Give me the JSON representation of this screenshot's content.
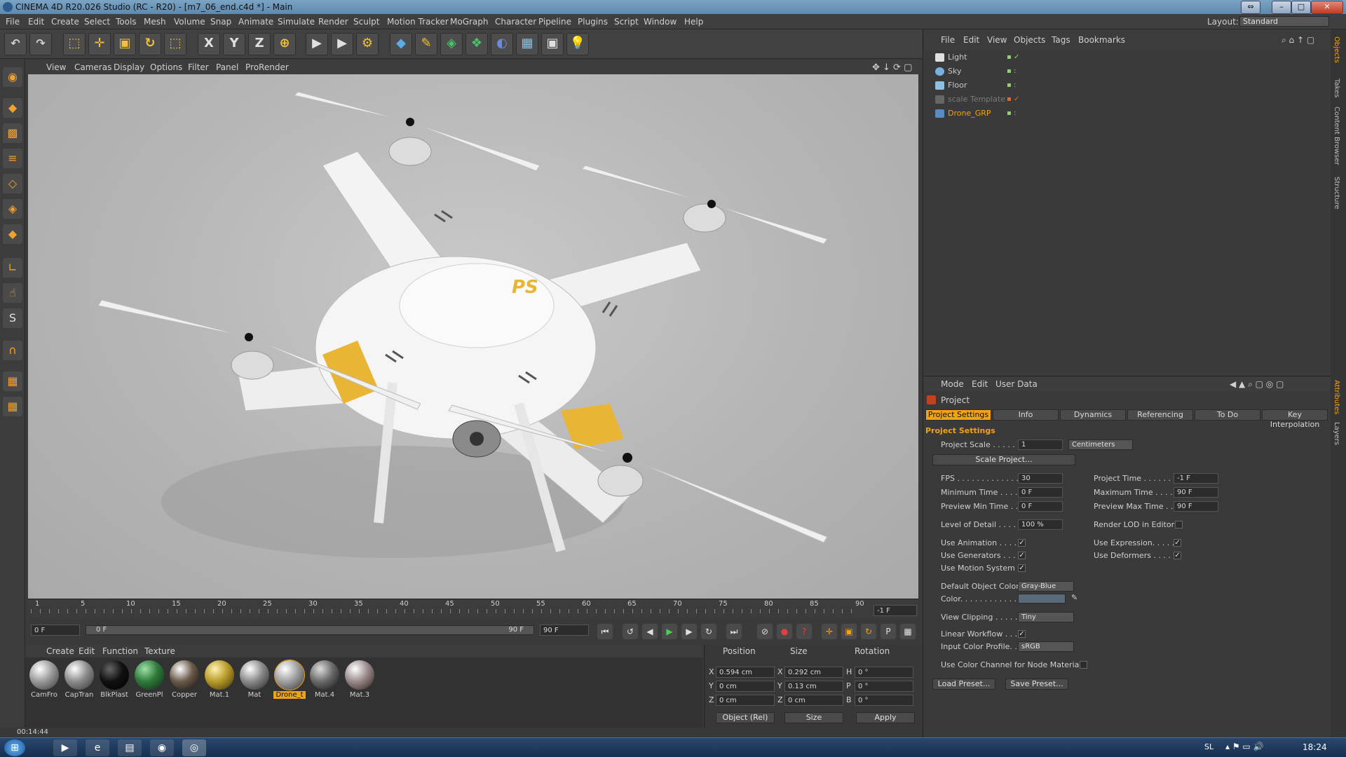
{
  "window": {
    "title": "CINEMA 4D R20.026 Studio (RC - R20) - [m7_06_end.c4d *] - Main",
    "layout_label": "Layout:",
    "layout_value": "Standard"
  },
  "menu": [
    "File",
    "Edit",
    "Create",
    "Select",
    "Tools",
    "Mesh",
    "Volume",
    "Snap",
    "Animate",
    "Simulate",
    "Render",
    "Sculpt",
    "Motion Tracker",
    "MoGraph",
    "Character",
    "Pipeline",
    "Plugins",
    "Script",
    "Window",
    "Help"
  ],
  "toolbar": {
    "axis_x": "X",
    "axis_y": "Y",
    "axis_z": "Z"
  },
  "viewport": {
    "menu": [
      "View",
      "Cameras",
      "Display",
      "Options",
      "Filter",
      "Panel",
      "ProRender"
    ],
    "logo_text": "PS"
  },
  "timeline": {
    "ticks": [
      "1",
      "5",
      "10",
      "15",
      "20",
      "25",
      "30",
      "35",
      "40",
      "45",
      "50",
      "55",
      "60",
      "65",
      "70",
      "75",
      "80",
      "85",
      "90"
    ],
    "current_frame": "-1 F"
  },
  "transport": {
    "start_field": "0 F",
    "range_start": "0 F",
    "range_end": "90 F",
    "end_field": "90 F"
  },
  "materials": {
    "menu": [
      "Create",
      "Edit",
      "Function",
      "Texture"
    ],
    "items": [
      {
        "label": "CamFro",
        "color": "#9a9a9a"
      },
      {
        "label": "CapTran",
        "color": "#8c8c8c"
      },
      {
        "label": "BlkPlast",
        "color": "#111111"
      },
      {
        "label": "GreenPl",
        "color": "#2e7a3a"
      },
      {
        "label": "Copper",
        "color": "#6a5a4a"
      },
      {
        "label": "Mat.1",
        "color": "#b89a2a"
      },
      {
        "label": "Mat",
        "color": "#8a8a8a"
      },
      {
        "label": "Drone_t",
        "color": "#a0a0a0"
      },
      {
        "label": "Mat.4",
        "color": "#6a6a6a"
      },
      {
        "label": "Mat.3",
        "color": "#9a8a8a"
      }
    ]
  },
  "coordinates": {
    "headers": [
      "Position",
      "Size",
      "Rotation"
    ],
    "rows": [
      {
        "axis": "X",
        "pos": "0.594 cm",
        "size_axis": "X",
        "size": "0.292 cm",
        "rot_axis": "H",
        "rot": "0 °"
      },
      {
        "axis": "Y",
        "pos": "0 cm",
        "size_axis": "Y",
        "size": "0.13 cm",
        "rot_axis": "P",
        "rot": "0 °"
      },
      {
        "axis": "Z",
        "pos": "0 cm",
        "size_axis": "Z",
        "size": "0 cm",
        "rot_axis": "B",
        "rot": "0 °"
      }
    ],
    "mode_dropdown": "Object (Rel)",
    "size_dropdown": "Size",
    "apply": "Apply"
  },
  "status": {
    "time": "00:14:44"
  },
  "objects": {
    "menu": [
      "File",
      "Edit",
      "View",
      "Objects",
      "Tags",
      "Bookmarks"
    ],
    "items": [
      {
        "name": "Light",
        "color": "#d0d0d0"
      },
      {
        "name": "Sky",
        "color": "#d0d0d0"
      },
      {
        "name": "Floor",
        "color": "#d0d0d0"
      },
      {
        "name": "scale Template",
        "color": "#7a7a7a"
      },
      {
        "name": "Drone_GRP",
        "color": "#f2a216"
      }
    ]
  },
  "side_tabs": [
    "Objects",
    "Takes",
    "Content Browser",
    "Structure",
    "Attributes",
    "Layers"
  ],
  "attributes": {
    "menu": [
      "Mode",
      "Edit",
      "User Data"
    ],
    "title": "Project",
    "tabs": [
      "Project Settings",
      "Info",
      "Dynamics",
      "Referencing",
      "To Do",
      "Key Interpolation"
    ],
    "section": "Project Settings",
    "project_scale_label": "Project Scale . . . . . .",
    "project_scale_value": "1",
    "project_scale_unit": "Centimeters",
    "scale_project_button": "Scale Project...",
    "fps_label": "FPS . . . . . . . . . . . . .",
    "fps": "30",
    "project_time_label": "Project Time . . . . . . .",
    "project_time": "-1 F",
    "min_time_label": "Minimum Time . . . . . .",
    "min_time": "0 F",
    "max_time_label": "Maximum Time . . . . .",
    "max_time": "90 F",
    "preview_min_label": "Preview Min Time . . .",
    "preview_min": "0 F",
    "preview_max_label": "Preview Max Time . . .",
    "preview_max": "90 F",
    "lod_label": "Level of Detail . . . . .",
    "lod": "100 %",
    "render_lod_label": "Render LOD in Editor",
    "use_animation": "Use Animation . . . . .",
    "use_expression": "Use Expression. . . . .",
    "use_generators": "Use Generators . . . .",
    "use_deformers": "Use Deformers . . . . .",
    "use_motion": "Use Motion System",
    "default_color_label": "Default Object Color",
    "default_color": "Gray-Blue",
    "color_label": "Color. . . . . . . . . . . .",
    "view_clipping_label": "View Clipping . . . . .",
    "view_clipping": "Tiny",
    "linear_workflow": "Linear Workflow . . .",
    "input_profile_label": "Input Color Profile. .",
    "input_profile": "sRGB",
    "node_material": "Use Color Channel for Node Material",
    "load_preset": "Load Preset...",
    "save_preset": "Save Preset..."
  },
  "taskbar": {
    "lang": "SL",
    "clock": "18:24"
  }
}
